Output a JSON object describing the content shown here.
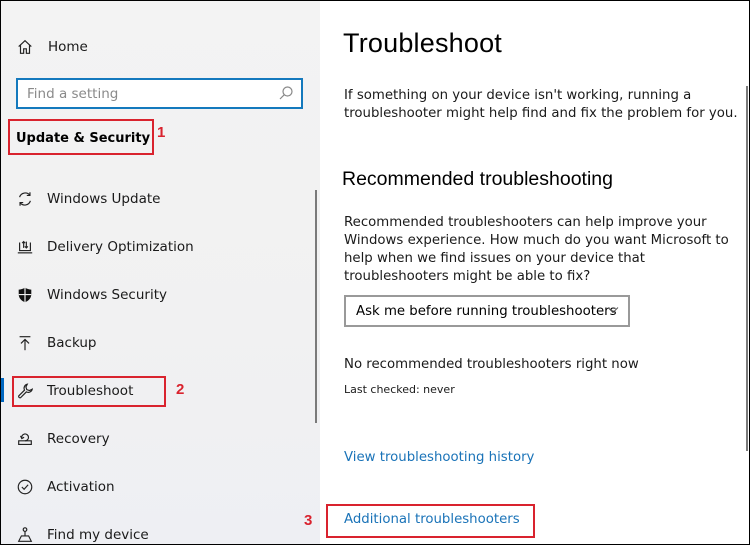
{
  "sidebar": {
    "home_label": "Home",
    "search": {
      "placeholder": "Find a setting",
      "value": ""
    },
    "section_title": "Update & Security",
    "items": [
      {
        "label": "Windows Update",
        "icon": "sync-icon"
      },
      {
        "label": "Delivery Optimization",
        "icon": "delivery-optimization-icon"
      },
      {
        "label": "Windows Security",
        "icon": "shield-icon"
      },
      {
        "label": "Backup",
        "icon": "backup-arrow-up-icon"
      },
      {
        "label": "Troubleshoot",
        "icon": "wrench-icon",
        "selected": true
      },
      {
        "label": "Recovery",
        "icon": "recovery-icon"
      },
      {
        "label": "Activation",
        "icon": "check-circle-icon"
      },
      {
        "label": "Find my device",
        "icon": "find-device-icon"
      }
    ]
  },
  "main": {
    "title": "Troubleshoot",
    "intro": "If something on your device isn't working, running a troubleshooter might help find and fix the problem for you.",
    "recommended": {
      "title": "Recommended troubleshooting",
      "description": "Recommended troubleshooters can help improve your Windows experience. How much do you want Microsoft to help when we find issues on your device that troubleshooters might be able to fix?",
      "dropdown_value": "Ask me before running troubleshooters",
      "status": "No recommended troubleshooters right now",
      "last_checked": "Last checked: never"
    },
    "links": {
      "history": "View troubleshooting history",
      "additional": "Additional troubleshooters"
    }
  },
  "annotations": {
    "step1": "1",
    "step2": "2",
    "step3": "3",
    "color": "#d9232e"
  },
  "colors": {
    "accent": "#0067c0",
    "link": "#1a73b8",
    "search_border": "#1479bd"
  }
}
